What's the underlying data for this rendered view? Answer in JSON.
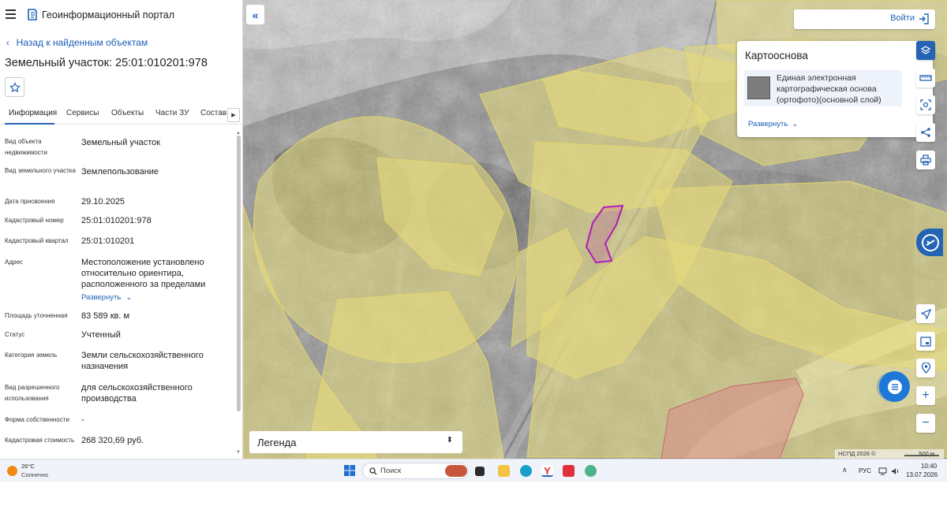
{
  "app": {
    "title": "Геоинформационный портал"
  },
  "nav": {
    "back": "Назад к найденным объектам"
  },
  "object": {
    "title": "Земельный участок: 25:01:010201:978"
  },
  "tabs": [
    "Информация",
    "Сервисы",
    "Объекты",
    "Части ЗУ",
    "Состав"
  ],
  "attributes": [
    {
      "label": "Вид объекта недвижимости",
      "value": "Земельный участок"
    },
    {
      "label": "Вид земельного участка",
      "value": "Землепользование"
    },
    {
      "label": "Дата присвоения",
      "value": "29.10.2025"
    },
    {
      "label": "Кадастровый номер",
      "value": "25:01:010201:978"
    },
    {
      "label": "Кадастровый квартал",
      "value": "25:01:010201"
    },
    {
      "label": "Адрес",
      "value": "Местоположение установлено относительно ориентира, расположенного за пределами",
      "expand": "Развернуть"
    },
    {
      "label": "Площадь уточненная",
      "value": "83 589 кв. м"
    },
    {
      "label": "Статус",
      "value": "Учтенный"
    },
    {
      "label": "Категория земель",
      "value": "Земли сельскохозяйственного назначения"
    },
    {
      "label": "Вид разрешенного использования",
      "value": "для сельскохозяйственного производства"
    },
    {
      "label": "Форма собственности",
      "value": "-"
    },
    {
      "label": "Кадастровая стоимость",
      "value": "268 320,69 руб."
    }
  ],
  "map": {
    "login": "Войти",
    "basemap": {
      "title": "Картооснова",
      "layer": "Единая электронная картографическая основа (ортофото)(основной слой)",
      "expand": "Развернуть"
    },
    "legend": "Легенда",
    "copyright": "НСПД 2026 ©",
    "scale": "500 м",
    "colors": {
      "parcels": "#e8dc7e",
      "selected": "#b01cb8",
      "zone": "#d98a8a",
      "accent": "#2563b4"
    }
  },
  "taskbar": {
    "weather_temp": "26°C",
    "weather_desc": "Солнечно",
    "search": "Поиск",
    "lang": "РУС",
    "time": "10:40",
    "date": "13.07.2026"
  },
  "icons": [
    "menu-icon",
    "logo-icon",
    "star-icon",
    "collapse-icon",
    "login-icon",
    "layers-icon",
    "ruler-icon",
    "select-area-icon",
    "share-icon",
    "print-icon",
    "assistant-icon",
    "navigate-icon",
    "minimap-icon",
    "location-icon",
    "zoom-in-icon",
    "zoom-out-icon",
    "chat-icon"
  ]
}
